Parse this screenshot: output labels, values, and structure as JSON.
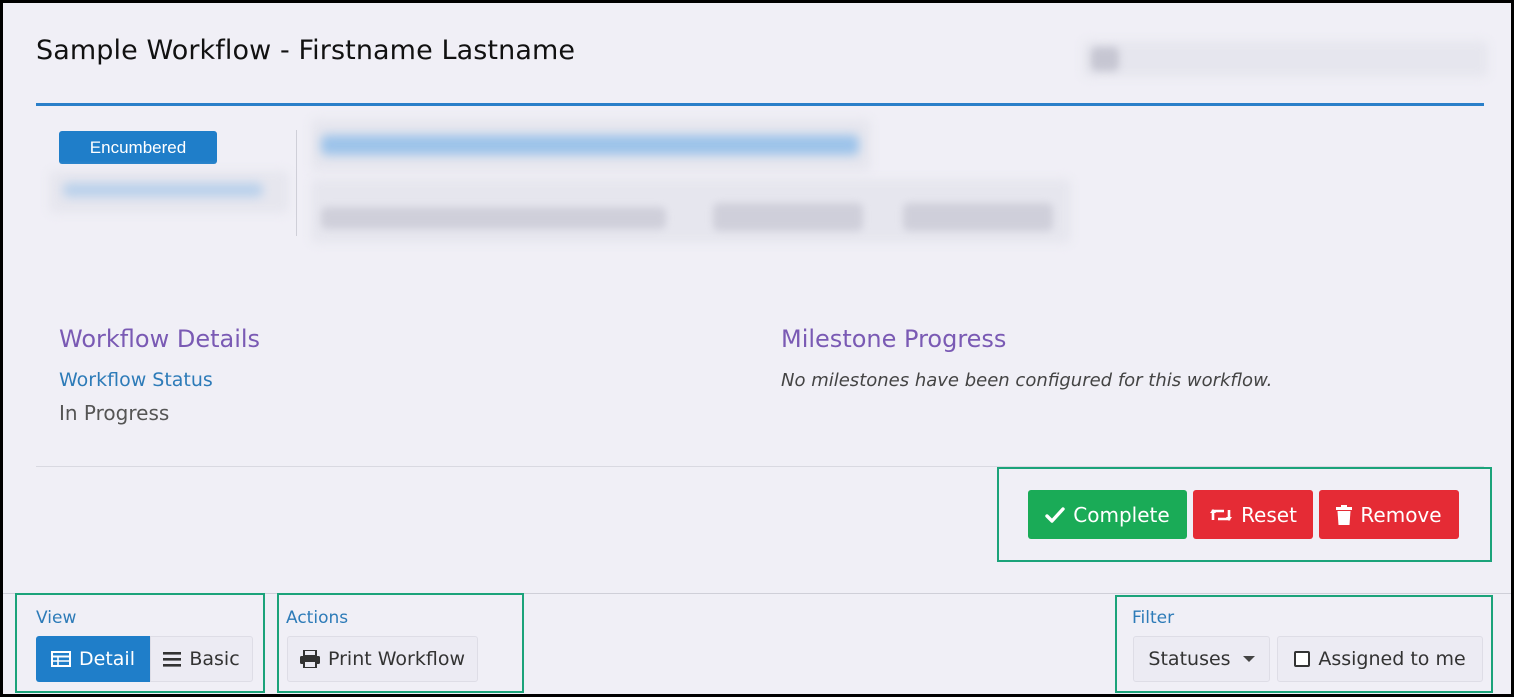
{
  "header": {
    "title": "Sample Workflow - Firstname Lastname"
  },
  "status_badge": "Encumbered",
  "workflow_details": {
    "heading": "Workflow Details",
    "status_label": "Workflow Status",
    "status_value": "In Progress"
  },
  "milestone_progress": {
    "heading": "Milestone Progress",
    "empty_message": "No milestones have been configured for this workflow."
  },
  "actions_bar": {
    "complete_label": "Complete",
    "reset_label": "Reset",
    "remove_label": "Remove"
  },
  "view_group": {
    "label": "View",
    "detail_label": "Detail",
    "basic_label": "Basic",
    "selected": "Detail"
  },
  "actions_group": {
    "label": "Actions",
    "print_label": "Print Workflow"
  },
  "filter_group": {
    "label": "Filter",
    "statuses_label": "Statuses",
    "assigned_label": "Assigned to me",
    "assigned_checked": false
  },
  "colors": {
    "primary": "#1f7ec9",
    "success": "#1aab57",
    "danger": "#e52b35",
    "heading_purple": "#7a5ab4",
    "label_blue": "#2d7bb8",
    "highlight_green": "#1ba37a"
  },
  "icons": {
    "complete": "check-icon",
    "reset": "retweet-icon",
    "remove": "trash-icon",
    "detail": "table-icon",
    "basic": "bars-icon",
    "print": "print-icon",
    "statuses": "caret-down-icon",
    "assigned": "checkbox-icon"
  }
}
